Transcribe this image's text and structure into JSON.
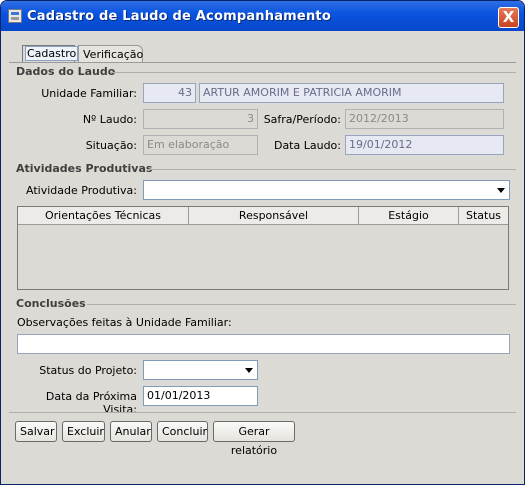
{
  "window": {
    "title": "Cadastro de Laudo de Acompanhamento",
    "close_label": "X"
  },
  "tabs": [
    {
      "label": "Cadastro",
      "active": true
    },
    {
      "label": "Verificação",
      "active": false
    }
  ],
  "dados_laudo": {
    "section_title": "Dados do Laudo",
    "unidade_familiar_label": "Unidade Familiar:",
    "unidade_familiar_id": "43",
    "unidade_familiar_nome": "ARTUR  AMORIM E PATRICIA AMORIM",
    "n_laudo_label": "Nº Laudo:",
    "n_laudo_value": "3",
    "safra_label": "Safra/Período:",
    "safra_value": "2012/2013",
    "situacao_label": "Situação:",
    "situacao_value": "Em elaboração",
    "data_laudo_label": "Data Laudo:",
    "data_laudo_value": "19/01/2012"
  },
  "atividades": {
    "section_title": "Atividades Produtivas",
    "atividade_label": "Atividade Produtiva:",
    "atividade_value": "",
    "table_headers": [
      "Orientações Técnicas",
      "Responsável",
      "Estágio",
      "Status"
    ],
    "rows": []
  },
  "conclusoes": {
    "section_title": "Conclusões",
    "observacoes_label": "Observações feitas à Unidade Familiar:",
    "observacoes_value": "",
    "status_projeto_label": "Status do Projeto:",
    "status_projeto_value": "",
    "data_visita_label": "Data da Próxima Visita:",
    "data_visita_value": "01/01/2013"
  },
  "buttons": {
    "salvar": "Salvar",
    "excluir": "Excluir",
    "anular": "Anular",
    "concluir": "Concluir",
    "gerar_relatorio": "Gerar relatório"
  },
  "colors": {
    "titlebar": "#0a54e0",
    "window_bg": "#dcdad5",
    "readonly_field": "#e6e9f2"
  }
}
